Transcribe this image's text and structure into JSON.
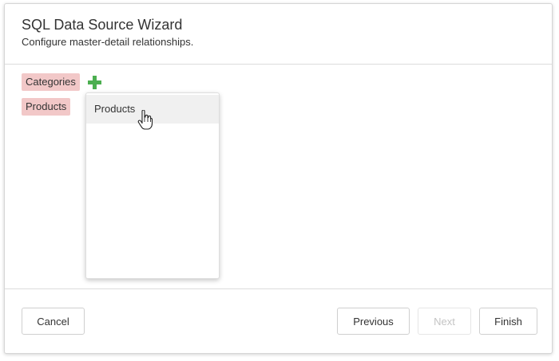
{
  "wizard": {
    "title": "SQL Data Source Wizard",
    "subtitle": "Configure master-detail relationships."
  },
  "tables": [
    {
      "label": "Categories"
    },
    {
      "label": "Products"
    }
  ],
  "dropdown": {
    "items": [
      {
        "label": "Products"
      }
    ]
  },
  "buttons": {
    "cancel": "Cancel",
    "previous": "Previous",
    "next": "Next",
    "finish": "Finish"
  },
  "colors": {
    "chip_background": "#f2c8c8",
    "add_icon": "#4caf50",
    "hover_background": "#f0f0f0"
  }
}
